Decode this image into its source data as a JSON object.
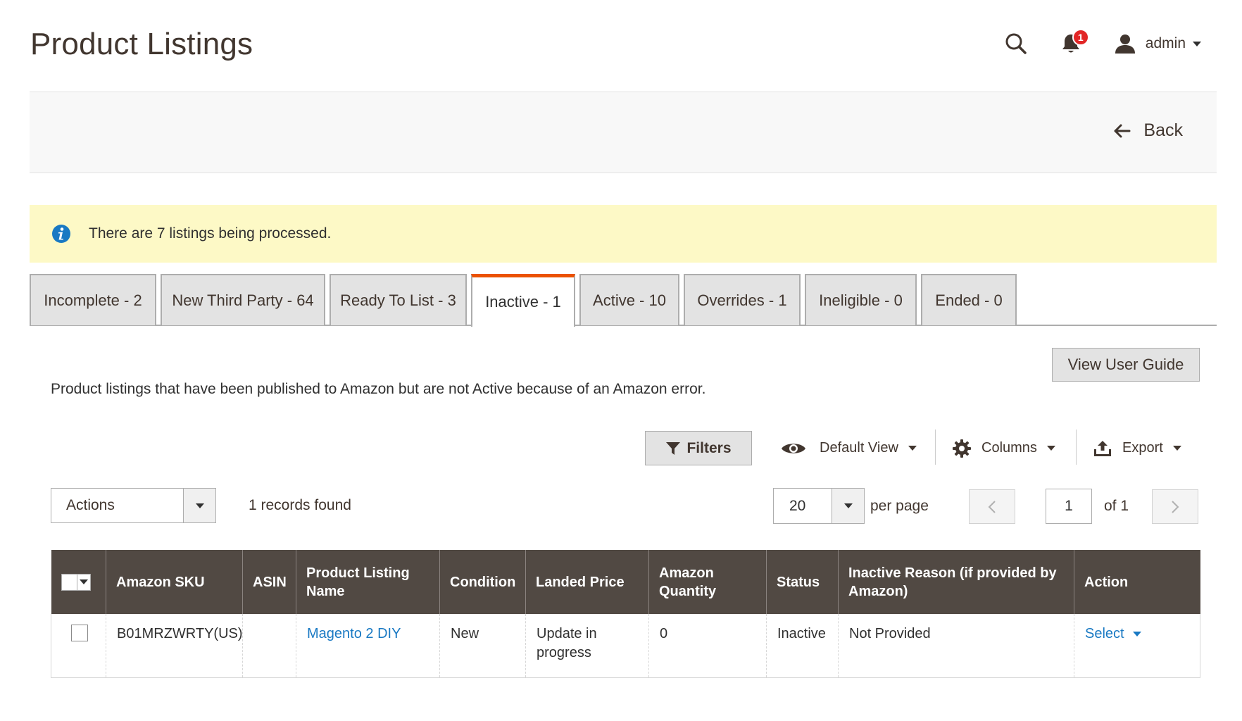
{
  "header": {
    "title": "Product Listings",
    "notification_count": "1",
    "user_name": "admin"
  },
  "action_bar": {
    "back_label": "Back"
  },
  "message": {
    "text": "There are 7 listings being processed."
  },
  "tabs": [
    {
      "label": "Incomplete - 2",
      "active": false
    },
    {
      "label": "New Third Party - 64",
      "active": false
    },
    {
      "label": "Ready To List - 3",
      "active": false
    },
    {
      "label": "Inactive - 1",
      "active": true
    },
    {
      "label": "Active - 10",
      "active": false
    },
    {
      "label": "Overrides - 1",
      "active": false
    },
    {
      "label": "Ineligible - 0",
      "active": false
    },
    {
      "label": "Ended - 0",
      "active": false
    }
  ],
  "guide_button": "View User Guide",
  "description": "Product listings that have been published to Amazon but are not Active because of an Amazon error.",
  "toolbar": {
    "filters_label": "Filters",
    "view_label": "Default View",
    "columns_label": "Columns",
    "export_label": "Export"
  },
  "mass_actions": {
    "label": "Actions"
  },
  "records_found": "1 records found",
  "pagination": {
    "per_page_value": "20",
    "per_page_label": "per page",
    "current_page": "1",
    "of_label": "of 1"
  },
  "grid": {
    "columns": [
      "Amazon SKU",
      "ASIN",
      "Product Listing Name",
      "Condition",
      "Landed Price",
      "Amazon Quantity",
      "Status",
      "Inactive Reason (if provided by Amazon)",
      "Action"
    ],
    "rows": [
      {
        "sku": "B01MRZWRTY(US)",
        "asin": "",
        "name": "Magento 2 DIY",
        "condition": "New",
        "landed_price": "Update in progress",
        "quantity": "0",
        "status": "Inactive",
        "inactive_reason": "Not Provided",
        "action": "Select"
      }
    ]
  },
  "colors": {
    "accent": "#eb5202",
    "grid_header": "#514943",
    "link": "#1979c3",
    "notice_bg": "#fdf9c6",
    "badge": "#e22626",
    "info_icon": "#1979c3"
  }
}
